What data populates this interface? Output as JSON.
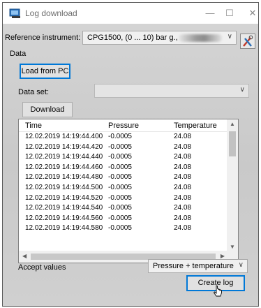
{
  "window": {
    "title": "Log download",
    "minimize_glyph": "—",
    "maximize_glyph": "☐",
    "close_glyph": "✕"
  },
  "reference": {
    "label": "Reference instrument:",
    "value": "CPG1500, (0 ... 10) bar g.,"
  },
  "data_section": {
    "label": "Data"
  },
  "load_button": {
    "label": "Load from PC"
  },
  "dataset": {
    "label": "Data set:",
    "value": ""
  },
  "download_button": {
    "label": "Download"
  },
  "table": {
    "columns": [
      "Time",
      "Pressure",
      "Temperature"
    ],
    "rows": [
      [
        "12.02.2019 14:19:44.400",
        "-0.0005",
        "24.08"
      ],
      [
        "12.02.2019 14:19:44.420",
        "-0.0005",
        "24.08"
      ],
      [
        "12.02.2019 14:19:44.440",
        "-0.0005",
        "24.08"
      ],
      [
        "12.02.2019 14:19:44.460",
        "-0.0005",
        "24.08"
      ],
      [
        "12.02.2019 14:19:44.480",
        "-0.0005",
        "24.08"
      ],
      [
        "12.02.2019 14:19:44.500",
        "-0.0005",
        "24.08"
      ],
      [
        "12.02.2019 14:19:44.520",
        "-0.0005",
        "24.08"
      ],
      [
        "12.02.2019 14:19:44.540",
        "-0.0005",
        "24.08"
      ],
      [
        "12.02.2019 14:19:44.560",
        "-0.0005",
        "24.08"
      ],
      [
        "12.02.2019 14:19:44.580",
        "-0.0005",
        "24.08"
      ]
    ]
  },
  "accept": {
    "label": "Accept values",
    "value": "Pressure + temperature"
  },
  "create_button": {
    "label": "Create log"
  },
  "colors": {
    "focus_border": "#0078d7",
    "window_bg": "#cfcfcf"
  }
}
